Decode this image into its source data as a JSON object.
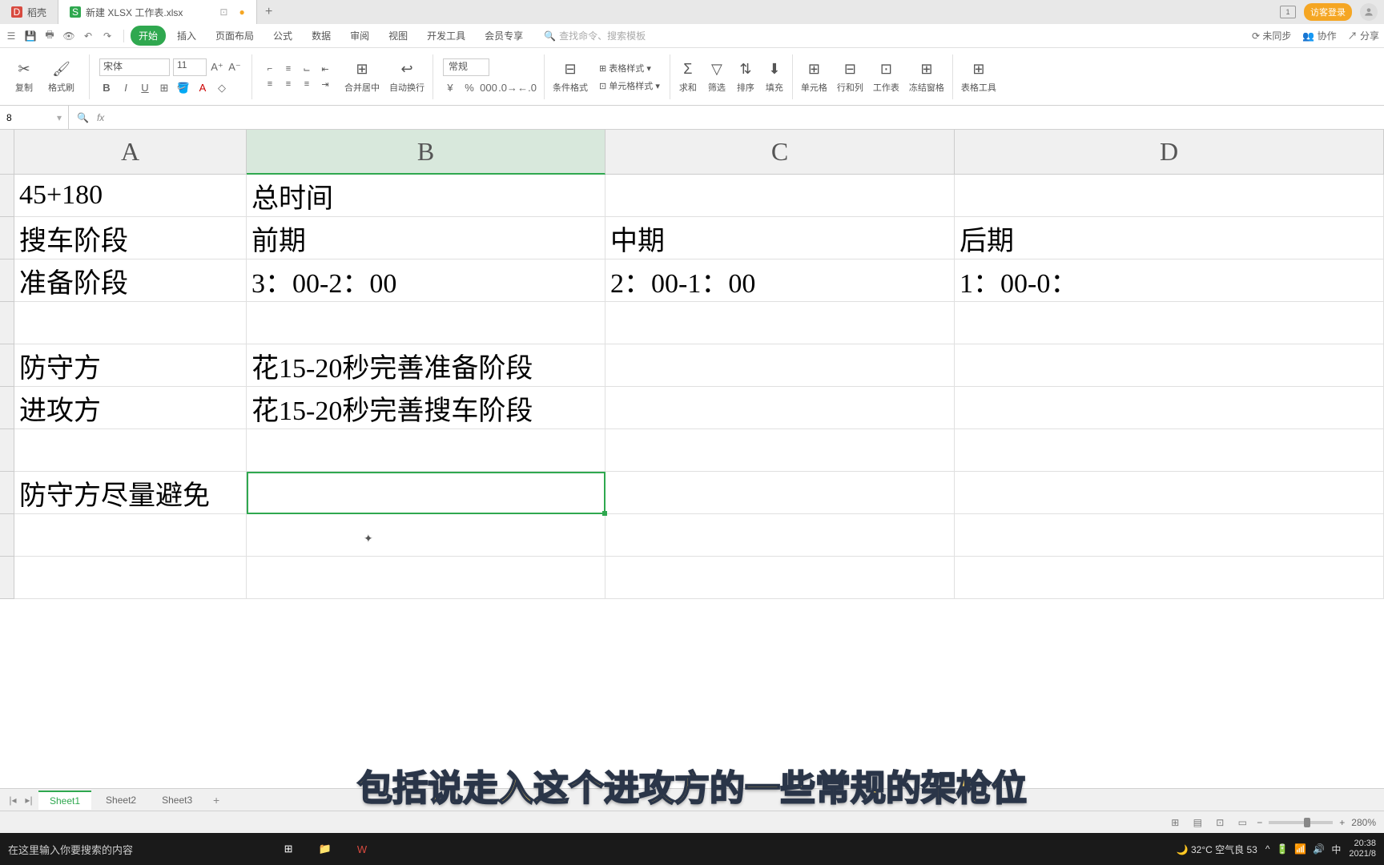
{
  "tabs": {
    "docer": "稻壳",
    "file": "新建 XLSX 工作表.xlsx"
  },
  "titleRight": {
    "login": "访客登录"
  },
  "menu": {
    "items": [
      "开始",
      "插入",
      "页面布局",
      "公式",
      "数据",
      "审阅",
      "视图",
      "开发工具",
      "会员专享"
    ],
    "searchPlaceholder": "查找命令、搜索模板",
    "unsync": "未同步",
    "coop": "协作",
    "share": "分享"
  },
  "ribbon": {
    "copy": "复制",
    "formatPainter": "格式刷",
    "fontName": "宋体",
    "fontSize": "11",
    "mergeCenter": "合并居中",
    "autoWrap": "自动换行",
    "numberFormat": "常规",
    "condFormat": "条件格式",
    "tableStyle": "表格样式",
    "cellStyle": "单元格样式",
    "sum": "求和",
    "filter": "筛选",
    "sort": "排序",
    "fill": "填充",
    "cells": "单元格",
    "rowsCols": "行和列",
    "worksheet": "工作表",
    "freeze": "冻结窗格",
    "tableTools": "表格工具"
  },
  "formulaBar": {
    "nameBox": "8",
    "fx": "fx"
  },
  "columns": [
    "A",
    "B",
    "C",
    "D"
  ],
  "cells": {
    "A1": "45+180",
    "B1": "总时间",
    "A2": "搜车阶段",
    "B2": "前期",
    "C2": "中期",
    "D2": "后期",
    "A3": "准备阶段",
    "B3": "3：00-2：00",
    "C3": "2：00-1：00",
    "D3": "1：00-0：",
    "A5": "防守方",
    "B5": "花15-20秒完善准备阶段",
    "A6": "进攻方",
    "B6": "花15-20秒完善搜车阶段",
    "A8": "防守方尽量避免"
  },
  "sheetTabs": [
    "Sheet1",
    "Sheet2",
    "Sheet3"
  ],
  "subtitle": "包括说走入这个进攻方的一些常规的架枪位",
  "status": {
    "zoomPct": "280%"
  },
  "taskbar": {
    "search": "在这里输入你要搜索的内容",
    "weather": "32°C 空气良 53",
    "ime": "中",
    "time": "20:38",
    "date": "2021/8"
  }
}
